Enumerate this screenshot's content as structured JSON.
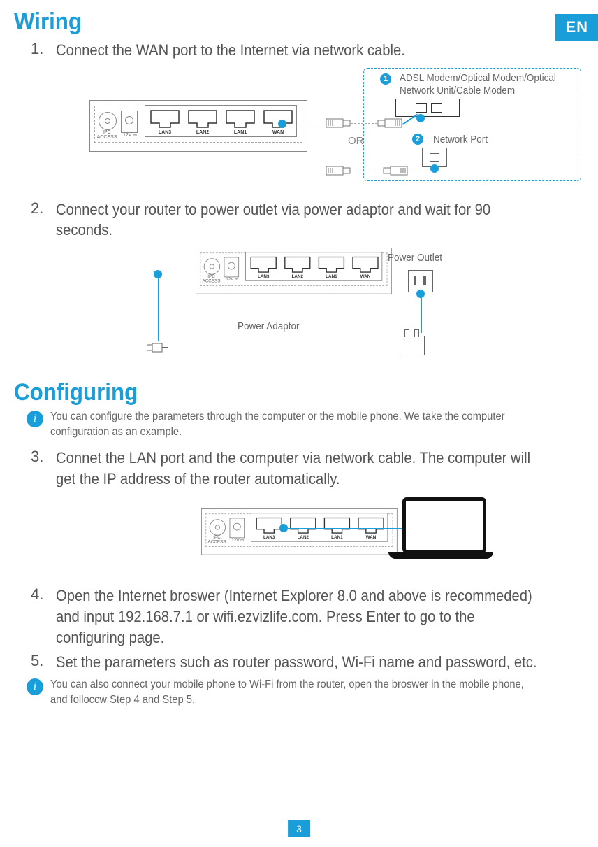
{
  "lang_tab": "EN",
  "page_number": "3",
  "sections": {
    "wiring": "Wiring",
    "configuring": "Configuring"
  },
  "steps": {
    "s1_num": "1.",
    "s1_text": "Connect the WAN port to the Internet via network cable.",
    "s2_num": "2.",
    "s2_text": "Connect your router to power outlet via power adaptor and wait for 90 seconds.",
    "s3_num": "3.",
    "s3_text": "Connet the LAN port and the computer via network cable. The computer will get the IP address of the router automatically.",
    "s4_num": "4.",
    "s4_text": "Open the Internet broswer (Internet Explorer 8.0 and above is recommeded) and input 192.168.7.1 or wifi.ezvizlife.com. Press Enter to go to the configuring page.",
    "s5_num": "5.",
    "s5_text": "Set the parameters such as router password, Wi-Fi name and password, etc."
  },
  "info": {
    "i_glyph": "i",
    "i1": "You can configure the parameters through the computer or the mobile phone. We take the computer configuration as an example.",
    "i2": "You can also connect your mobile phone to Wi-Fi from the router, open the broswer in the mobile phone, and folloccw Step 4 and Step 5."
  },
  "router": {
    "ipc": "IPC\nACCESS",
    "v12": "12V ⎓",
    "lan3": "LAN3",
    "lan2": "LAN2",
    "lan1": "LAN1",
    "wan": "WAN"
  },
  "fig1": {
    "modem_label": "ADSL Modem/Optical Modem/Optical Network Unit/Cable Modem",
    "network_port_label": "Network Port",
    "or": "OR",
    "badge1": "1",
    "badge2": "2"
  },
  "fig2": {
    "power_outlet": "Power Outlet",
    "power_adaptor": "Power Adaptor"
  }
}
